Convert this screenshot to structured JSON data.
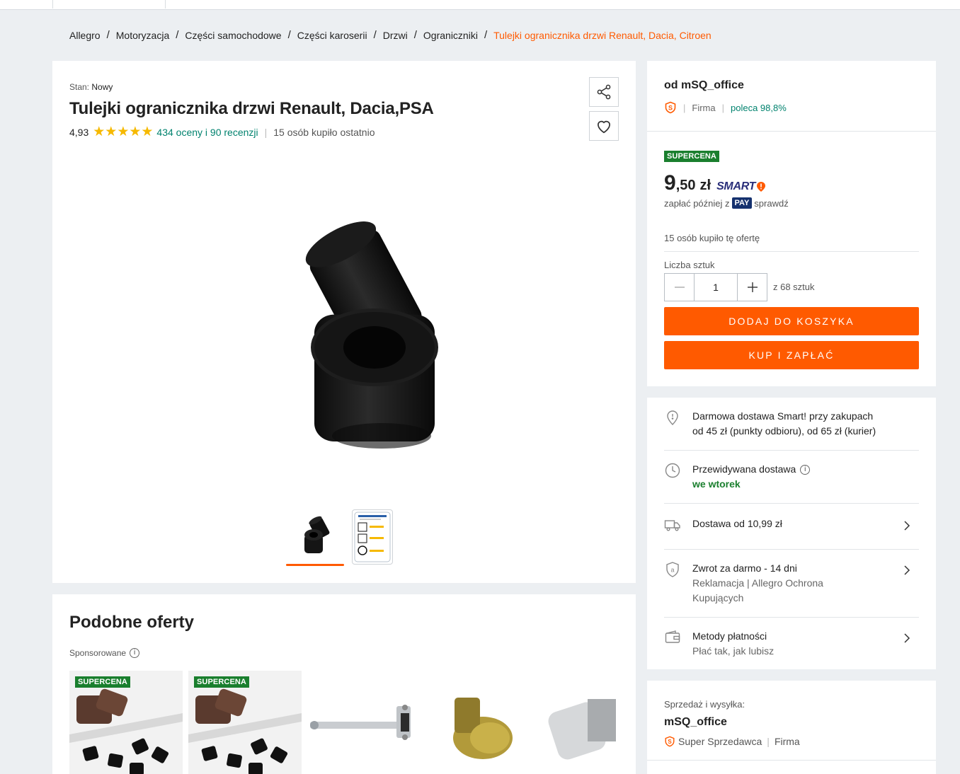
{
  "breadcrumb": {
    "items": [
      "Allegro",
      "Motoryzacja",
      "Części samochodowe",
      "Części karoserii",
      "Drzwi",
      "Ograniczniki"
    ],
    "separator": "/",
    "current": "Tulejki ogranicznika drzwi Renault, Dacia, Citroen"
  },
  "product": {
    "condition_label": "Stan:",
    "condition_value": "Nowy",
    "title": "Tulejki ogranicznika drzwi Renault, Dacia,PSA",
    "rating_score": "4,93",
    "rating_value": 4.93,
    "rating_max": 5,
    "reviews_text": "434 oceny i 90 recenzji",
    "bought_recently": "15 osób kupiło ostatnio",
    "share_icon": "share-icon",
    "favorite_icon": "heart-icon"
  },
  "similar": {
    "title": "Podobne oferty",
    "sponsored_label": "Sponsorowane",
    "badge": "SUPERCENA"
  },
  "seller": {
    "prefix_name": "od mSQ_office",
    "type": "Firma",
    "recommend": "poleca 98,8%"
  },
  "price": {
    "badge": "SUPERCENA",
    "integer": "9",
    "decimal": ",50",
    "currency": "zł",
    "smart_label": "SMART",
    "pay_later_prefix": "zapłać później z",
    "pay_badge": "PAY",
    "pay_later_suffix": "sprawdź",
    "bought_offer": "15 osób kupiło tę ofertę",
    "quantity_label": "Liczba sztuk",
    "quantity_value": "1",
    "quantity_of": "z 68 sztuk",
    "add_to_cart": "DODAJ DO KOSZYKA",
    "buy_now": "KUP I ZAPŁAĆ"
  },
  "delivery": {
    "free_line1": "Darmowa dostawa Smart! przy zakupach",
    "free_line2": "od 45 zł (punkty odbioru), od 65 zł (kurier)",
    "expected_label": "Przewidywana dostawa",
    "expected_value": "we wtorek",
    "shipping_from": "Dostawa od 10,99 zł",
    "return_title": "Zwrot za darmo - 14 dni",
    "return_line2": "Reklamacja | Allegro Ochrona",
    "return_line3": "Kupujących",
    "payment_title": "Metody płatności",
    "payment_sub": "Płać tak, jak lubisz"
  },
  "sales": {
    "label": "Sprzedaż i wysyłka:",
    "seller_name": "mSQ_office",
    "super_seller": "Super Sprzedawca",
    "type": "Firma"
  },
  "colors": {
    "accent_orange": "#ff5a00",
    "teal_link": "#00826e",
    "supercena_green": "#1a7f2e",
    "star_yellow": "#f6b900"
  }
}
